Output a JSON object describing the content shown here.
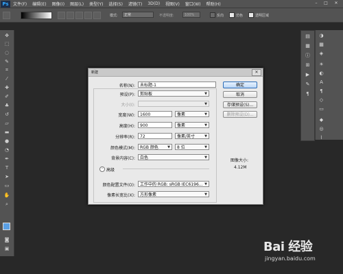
{
  "app": {
    "logo": "Ps"
  },
  "menubar": {
    "items": [
      "文件(F)",
      "编辑(E)",
      "图像(I)",
      "图层(L)",
      "类型(Y)",
      "选择(S)",
      "滤镜(T)",
      "3D(D)",
      "视图(V)",
      "窗口(W)",
      "帮助(H)"
    ],
    "min": "–",
    "max": "□",
    "close": "✕"
  },
  "options_bar": {
    "mode_label": "模式:",
    "mode_value": "正常",
    "opacity_label": "不透明度:",
    "opacity_value": "100%",
    "reverse_label": "反向",
    "dither_label": "仿色",
    "transparency_label": "透明区域"
  },
  "dialog": {
    "title": "新建",
    "close": "✕",
    "name_label": "名称(N):",
    "name_value": "未标题-1",
    "preset_label": "预设(P):",
    "preset_value": "剪贴板",
    "size_label": "大小(I):",
    "width_label": "宽度(W):",
    "width_value": "1600",
    "width_unit": "像素",
    "height_label": "高度(H):",
    "height_value": "900",
    "height_unit": "像素",
    "resolution_label": "分辨率(R):",
    "resolution_value": "72",
    "resolution_unit": "像素/英寸",
    "color_mode_label": "颜色模式(M):",
    "color_mode_value": "RGB 颜色",
    "bit_depth_value": "8 位",
    "background_label": "背景内容(C):",
    "background_value": "白色",
    "advanced_label": "高级",
    "profile_label": "颜色配置文件(O):",
    "profile_value": "工作中的 RGB: sRGB IEC6196...",
    "aspect_label": "像素长宽比(X):",
    "aspect_value": "方形像素",
    "ok_button": "确定",
    "cancel_button": "取消",
    "save_preset_button": "存储预设(S)...",
    "delete_preset_button": "删除预设(D)...",
    "image_size_label": "图像大小:",
    "image_size_value": "4.12M"
  },
  "watermark": {
    "brand": "Bai 经验",
    "url": "jingyan.baidu.com"
  },
  "colors": {
    "app_bg": "#282828",
    "panel": "#535353",
    "dialog": "#e9e9e9",
    "primary_button_border": "#2a6bb7"
  }
}
